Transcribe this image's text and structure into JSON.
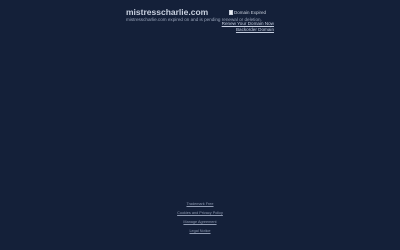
{
  "header": {
    "domain": "mistresscharlie.com",
    "notice": "mistresscharlie.com expired on and is pending renewal or deletion."
  },
  "image": {
    "alt": "Domain Expired"
  },
  "links": {
    "renew": "Renew Your Domain Now",
    "backorder": "Backorder Domain"
  },
  "footer": {
    "trademark": "Trademark Free",
    "cookies": "Cookies and Privacy Policy",
    "manage": "Manage Agreement",
    "legal": "Legal Notice"
  }
}
